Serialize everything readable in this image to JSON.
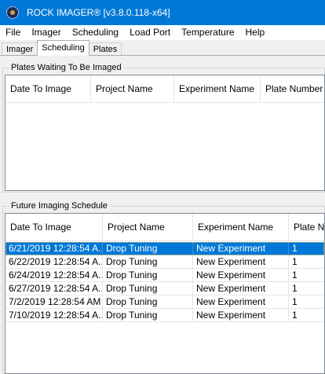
{
  "window": {
    "title": "ROCK IMAGER® [v3.8.0.118-x64]"
  },
  "menu": [
    "File",
    "Imager",
    "Scheduling",
    "Load Port",
    "Temperature",
    "Help"
  ],
  "tabs": [
    {
      "label": "Imager",
      "active": false
    },
    {
      "label": "Scheduling",
      "active": true
    },
    {
      "label": "Plates",
      "active": false
    }
  ],
  "waiting": {
    "title": "Plates Waiting To Be Imaged",
    "columns": [
      "Date To Image",
      "Project Name",
      "Experiment Name",
      "Plate Number"
    ],
    "rows": []
  },
  "future": {
    "title": "Future Imaging Schedule",
    "columns": [
      "Date To Image",
      "Project Name",
      "Experiment Name",
      "Plate Nu"
    ],
    "rows": [
      {
        "date": "6/21/2019 12:28:54  A...",
        "project": "Drop Tuning",
        "experiment": "New Experiment",
        "plate": "1",
        "selected": true
      },
      {
        "date": "6/22/2019 12:28:54  A...",
        "project": "Drop Tuning",
        "experiment": "New Experiment",
        "plate": "1",
        "selected": false
      },
      {
        "date": "6/24/2019 12:28:54  A...",
        "project": "Drop Tuning",
        "experiment": "New Experiment",
        "plate": "1",
        "selected": false
      },
      {
        "date": "6/27/2019 12:28:54  A...",
        "project": "Drop Tuning",
        "experiment": "New Experiment",
        "plate": "1",
        "selected": false
      },
      {
        "date": "7/2/2019 12:28:54 AM",
        "project": "Drop Tuning",
        "experiment": "New Experiment",
        "plate": "1",
        "selected": false
      },
      {
        "date": "7/10/2019 12:28:54  A...",
        "project": "Drop Tuning",
        "experiment": "New Experiment",
        "plate": "1",
        "selected": false
      }
    ]
  },
  "colors": {
    "titlebar": "#0078d7",
    "selection": "#0078d7"
  }
}
